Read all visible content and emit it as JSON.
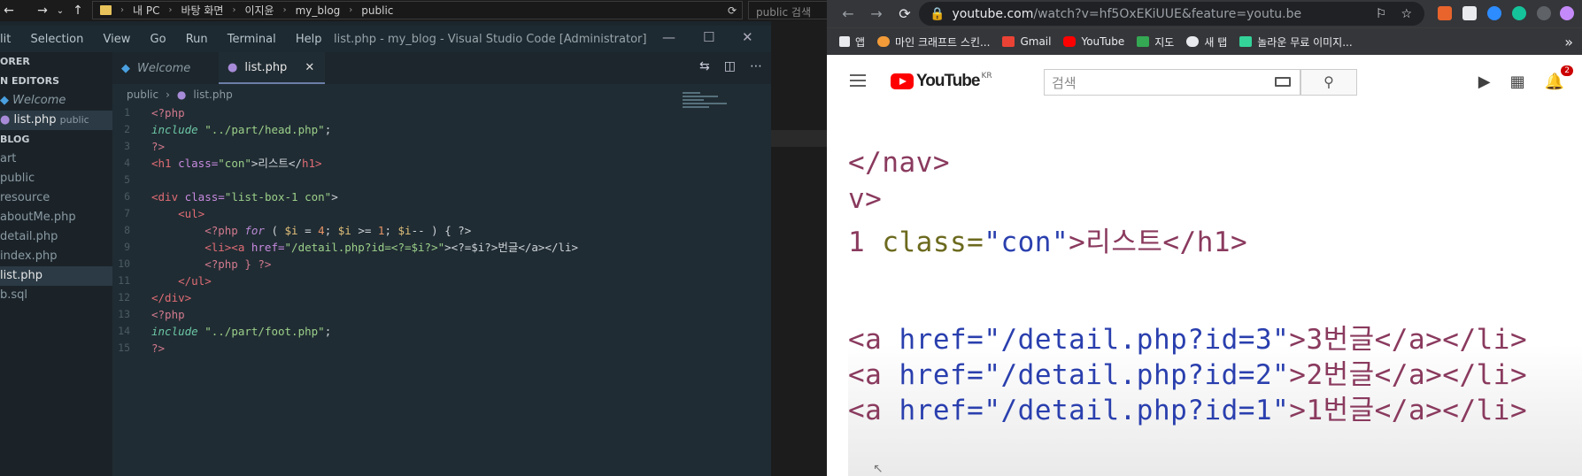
{
  "explorer": {
    "path": [
      "내 PC",
      "바탕 화면",
      "이지윤",
      "my_blog",
      "public"
    ],
    "search_placeholder": "public 검색"
  },
  "vscode": {
    "menu": [
      "lit",
      "Selection",
      "View",
      "Go",
      "Run",
      "Terminal",
      "Help"
    ],
    "title": "list.php - my_blog - Visual Studio Code [Administrator]",
    "sidebar": {
      "header1": "ORER",
      "header2": "N EDITORS",
      "open_editors": [
        {
          "label": "Welcome",
          "suffix": ""
        },
        {
          "label": "list.php",
          "suffix": "public"
        }
      ],
      "header3": "BLOG",
      "files": [
        "art",
        "public",
        "resource",
        "aboutMe.php",
        "detail.php",
        "index.php",
        "list.php",
        "b.sql"
      ]
    },
    "tabs": [
      {
        "label": "Welcome"
      },
      {
        "label": "list.php"
      }
    ],
    "breadcrumb": [
      "public",
      "list.php"
    ],
    "line_numbers": [
      "1",
      "2",
      "3",
      "4",
      "5",
      "6",
      "7",
      "8",
      "9",
      "10",
      "11",
      "12",
      "13",
      "14",
      "15"
    ],
    "code": {
      "l1": "<?php",
      "l2_kw": "include",
      "l2_str": "\"../part/head.php\"",
      "l2_end": ";",
      "l3": "?>",
      "l4_open": "<h1",
      "l4_attr": " class=",
      "l4_val": "\"con\"",
      "l4_text": ">리스트</",
      "l4_close": "h1>",
      "l6_open": "<div",
      "l6_attr": " class=",
      "l6_val": "\"list-box-1 con\"",
      "l6_end": ">",
      "l7": "    <ul>",
      "l8_open": "        <?php ",
      "l8_for": "for",
      "l8_a": " ( ",
      "l8_i1": "$i",
      "l8_b": " = ",
      "l8_n1": "4",
      "l8_c": "; ",
      "l8_i2": "$i",
      "l8_d": " >= ",
      "l8_n2": "1",
      "l8_e": "; ",
      "l8_i3": "$i",
      "l8_f": "-- ) { ?>",
      "l9_li": "        <li><a",
      "l9_attr": " href=",
      "l9_val": "\"/detail.php?id=<?=$i?>\"",
      "l9_rest": "><?=$i?>번글</a></li>",
      "l10": "        <?php } ?>",
      "l11": "    </ul>",
      "l12": "</div>",
      "l13": "<?php",
      "l14_kw": "include",
      "l14_str": "\"../part/foot.php\"",
      "l14_end": ";",
      "l15": "?>"
    }
  },
  "chrome": {
    "url_host": "youtube.com",
    "url_rest": "/watch?v=hf5OxEKiUUE&feature=youtu.be",
    "bookmarks": [
      "앱",
      "마인 크래프트 스킨...",
      "Gmail",
      "YouTube",
      "지도",
      "새 탭",
      "놀라운 무료 이미지..."
    ],
    "more": "»"
  },
  "youtube": {
    "region": "KR",
    "search_placeholder": "검색",
    "notifications": "2",
    "video_lines": {
      "v1": "</nav>",
      "v2": "v>",
      "v3a": "1 ",
      "v3b": "class=",
      "v3c": "\"con\"",
      "v3d": ">리스트</h1>",
      "v4a": "<a ",
      "v4b": "href=",
      "v4c": "\"/detail.php?id=3\"",
      "v4d": ">3번글</a></li>",
      "v5c": "\"/detail.php?id=2\"",
      "v5d": ">2번글</a></li>",
      "v6c": "\"/detail.php?id=1\"",
      "v6d": ">1번글</a></li>"
    }
  },
  "colors": {
    "vscode_bg": "#202c33",
    "youtube_red": "#ff0000",
    "chrome_dark": "#35363a"
  }
}
